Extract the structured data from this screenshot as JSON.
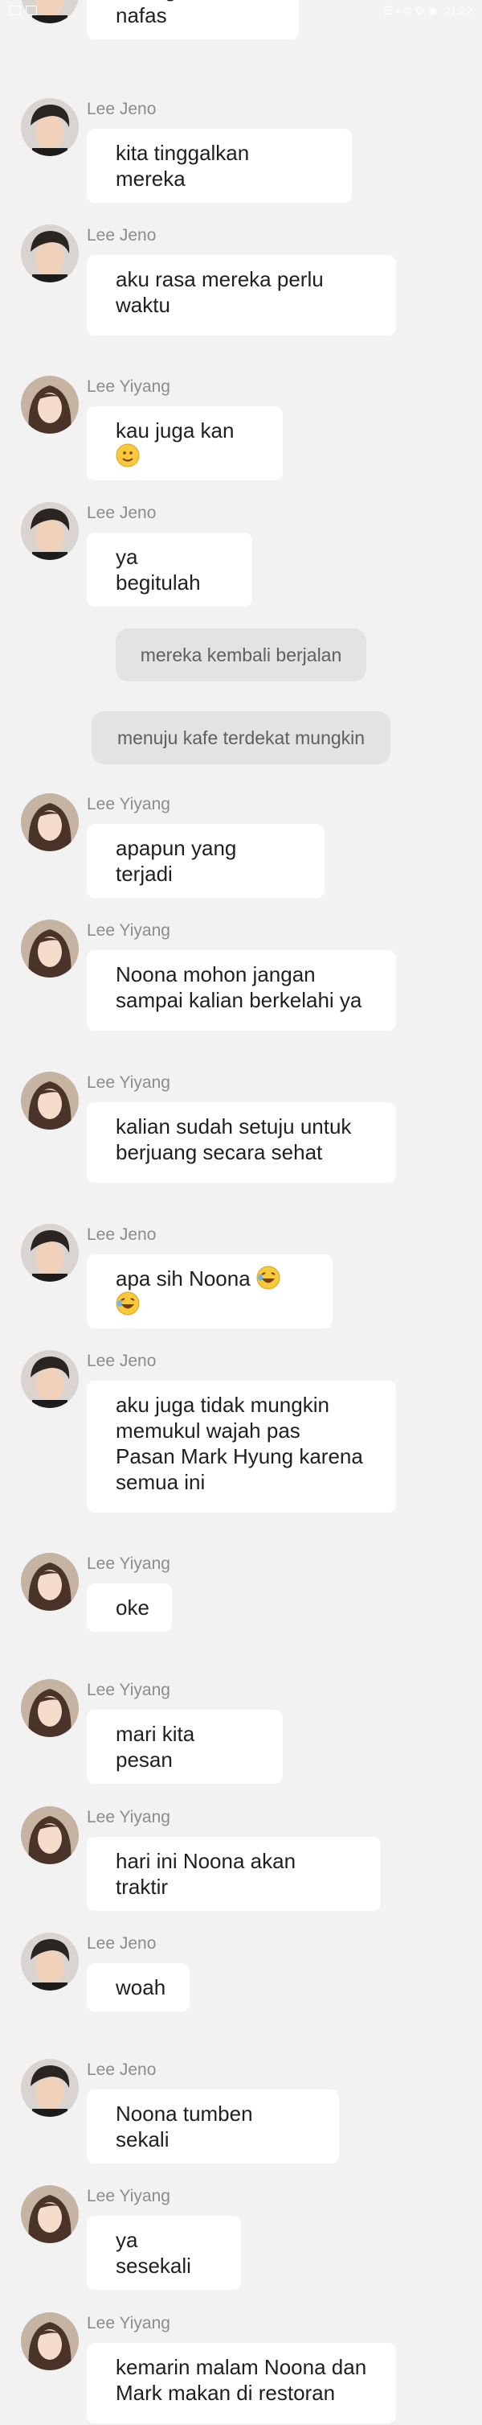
{
  "status_bar": {
    "time": "21:22",
    "indicators": "☰ • © ⚙ ◉"
  },
  "messages": [
    {
      "type": "bubble",
      "sender": "",
      "avatar": "jeno",
      "text": "*menghela nafas"
    },
    {
      "type": "bubble",
      "sender": "Lee Jeno",
      "avatar": "jeno",
      "text": "kita tinggalkan mereka"
    },
    {
      "type": "bubble",
      "sender": "Lee Jeno",
      "avatar": "jeno",
      "text": "aku rasa mereka perlu\nwaktu"
    },
    {
      "type": "bubble",
      "sender": "Lee Yiyang",
      "avatar": "yiyang",
      "text": "kau juga kan",
      "emoji": "slight-smile"
    },
    {
      "type": "bubble",
      "sender": "Lee Jeno",
      "avatar": "jeno",
      "text": "ya begitulah"
    },
    {
      "type": "narration",
      "text": "mereka kembali berjalan"
    },
    {
      "type": "narration",
      "text": "menuju kafe terdekat mungkin"
    },
    {
      "type": "bubble",
      "sender": "Lee Yiyang",
      "avatar": "yiyang",
      "text": "apapun yang terjadi"
    },
    {
      "type": "bubble",
      "sender": "Lee Yiyang",
      "avatar": "yiyang",
      "text": "Noona mohon jangan\nsampai kalian berkelahi ya"
    },
    {
      "type": "bubble",
      "sender": "Lee Yiyang",
      "avatar": "yiyang",
      "text": "kalian sudah setuju untuk\nberjuang secara sehat"
    },
    {
      "type": "bubble",
      "sender": "Lee Jeno",
      "avatar": "jeno",
      "text": "apa sih Noona ",
      "emoji": "laugh-x2"
    },
    {
      "type": "bubble",
      "sender": "Lee Jeno",
      "avatar": "jeno",
      "text": "aku juga tidak mungkin\nmemukul wajah pas\nPasan Mark Hyung karena\nsemua ini"
    },
    {
      "type": "bubble",
      "sender": "Lee Yiyang",
      "avatar": "yiyang",
      "text": "oke"
    },
    {
      "type": "bubble",
      "sender": "Lee Yiyang",
      "avatar": "yiyang",
      "text": "mari kita pesan"
    },
    {
      "type": "bubble",
      "sender": "Lee Yiyang",
      "avatar": "yiyang",
      "text": "hari ini Noona akan traktir"
    },
    {
      "type": "bubble",
      "sender": "Lee Jeno",
      "avatar": "jeno",
      "text": "woah"
    },
    {
      "type": "bubble",
      "sender": "Lee Jeno",
      "avatar": "jeno",
      "text": "Noona tumben sekali"
    },
    {
      "type": "bubble",
      "sender": "Lee Yiyang",
      "avatar": "yiyang",
      "text": "ya sesekali"
    },
    {
      "type": "bubble",
      "sender": "Lee Yiyang",
      "avatar": "yiyang",
      "text": "kemarin malam Noona dan\nMark makan di restoran"
    }
  ],
  "colors": {
    "background": "#f2f2f2",
    "bubble": "#ffffff",
    "narration": "#e3e3e3",
    "sender": "#8c8c8c"
  }
}
